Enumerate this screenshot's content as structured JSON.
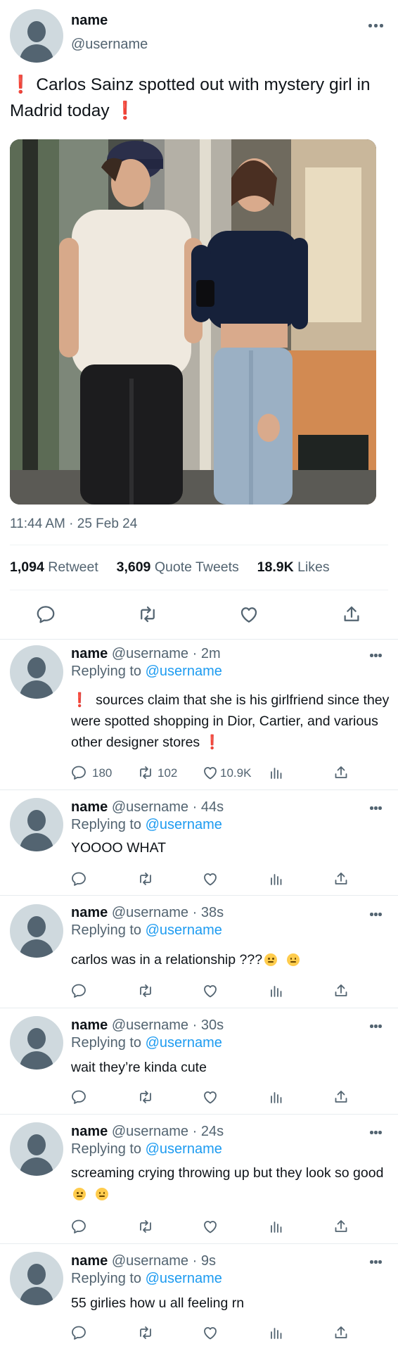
{
  "main_tweet": {
    "name": "name",
    "handle": "@username",
    "text_pre": "❗",
    "text": " Carlos Sainz spotted out with mystery girl in Madrid today ",
    "text_post": "❗",
    "photo_icon": "photo-of-two-people-walking",
    "timestamp": "11:44 AM · 25 Feb 24",
    "stats": {
      "retweets": "1,094",
      "retweets_label": " Retweet",
      "quotes": "3,609",
      "quotes_label": " Quote Tweets",
      "likes": "18.9K",
      "likes_label": " Likes"
    }
  },
  "replies": [
    {
      "name": "name",
      "handle_time": "@username · 2m",
      "replying_label": "Replying to ",
      "replying_to": "@username",
      "text": "sources claim that she is his girlfriend since they were spotted shopping in Dior, Cartier, and various other designer stores ",
      "text_pre": "❗",
      "text_post": "❗",
      "counts": {
        "reply": "180",
        "retweet": "102",
        "like": "10.9K"
      }
    },
    {
      "name": "name",
      "handle_time": "@username · 44s",
      "replying_label": "Replying to ",
      "replying_to": "@username",
      "text": "YOOOO WHAT"
    },
    {
      "name": "name",
      "handle_time": "@username · 38s",
      "replying_label": "Replying to ",
      "replying_to": "@username",
      "text": "carlos was in a relationship ???",
      "emojis": [
        "grinning-face",
        "grinning-face"
      ]
    },
    {
      "name": "name",
      "handle_time": "@username · 30s",
      "replying_label": "Replying to ",
      "replying_to": "@username",
      "text": "wait they’re kinda cute"
    },
    {
      "name": "name",
      "handle_time": "@username · 24s",
      "replying_label": "Replying to ",
      "replying_to": "@username",
      "text": "screaming crying throwing up but they look so good",
      "emojis": [
        "persevering-face",
        "persevering-face"
      ]
    },
    {
      "name": "name",
      "handle_time": "@username · 9s",
      "replying_label": "Replying to ",
      "replying_to": "@username",
      "text": "55 girlies how u all feeling rn"
    }
  ],
  "colors": {
    "text": "#0f1419",
    "secondary": "#536471",
    "link": "#1d9bf0",
    "alert": "#e0245e",
    "avatar_bg": "#cfd9de"
  },
  "icons": [
    "reply-icon",
    "retweet-icon",
    "like-icon",
    "analytics-icon",
    "share-icon",
    "more-icon"
  ]
}
